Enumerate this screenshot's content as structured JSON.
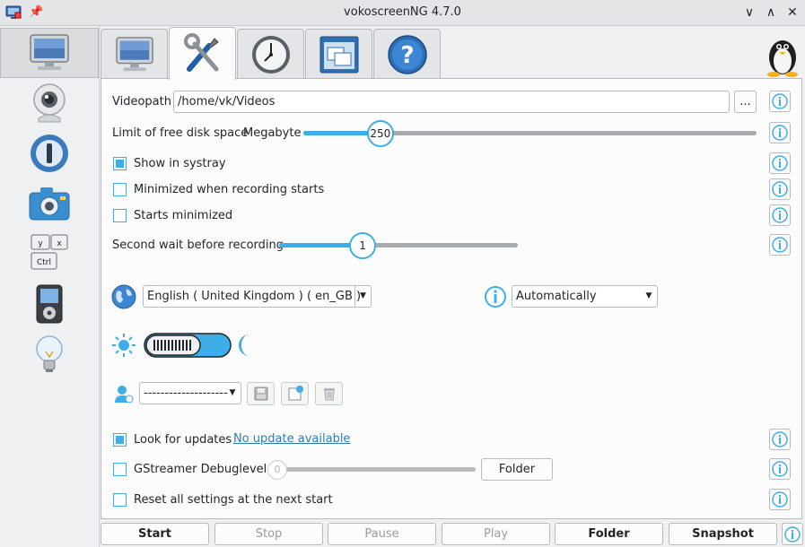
{
  "window": {
    "title": "vokoscreenNG 4.7.0",
    "pin_icon": "pin-icon",
    "controls": {
      "minimize": "∨",
      "maximize": "∧",
      "close": "✕"
    }
  },
  "sidebar": {
    "items": [
      {
        "name": "screen",
        "icon": "monitor-icon",
        "active": true
      },
      {
        "name": "webcam",
        "icon": "webcam-icon"
      },
      {
        "name": "player",
        "icon": "player-icon"
      },
      {
        "name": "camera",
        "icon": "camera-icon"
      },
      {
        "name": "keys",
        "icon": "keyboard-keys-icon",
        "keys": [
          "y",
          "x",
          "Ctrl"
        ]
      },
      {
        "name": "media-player",
        "icon": "media-player-icon"
      },
      {
        "name": "tips",
        "icon": "lightbulb-icon"
      }
    ]
  },
  "tabs": [
    {
      "name": "screen",
      "icon": "monitor-icon"
    },
    {
      "name": "settings",
      "icon": "tools-icon",
      "active": true
    },
    {
      "name": "timer",
      "icon": "clock-icon"
    },
    {
      "name": "windows",
      "icon": "windows-icon"
    },
    {
      "name": "help",
      "icon": "help-icon",
      "glyph": "?"
    }
  ],
  "settings": {
    "videopath_label": "Videopath",
    "videopath_value": "/home/vk/Videos",
    "browse_label": "...",
    "disk_space_label": "Limit of free disk space",
    "disk_space_unit": "Megabyte",
    "disk_space_value": "250",
    "disk_space_fraction": 0.17,
    "show_systray_label": "Show in systray",
    "show_systray_checked": true,
    "minimized_recording_label": "Minimized when recording starts",
    "minimized_recording_checked": false,
    "starts_minimized_label": "Starts minimized",
    "starts_minimized_checked": false,
    "wait_label": "Second wait before recording",
    "wait_value": "1",
    "wait_fraction": 0.35,
    "language_value": "English  ( United Kingdom )  ( en_GB )",
    "style_value": "Automatically",
    "theme_toggle": "dark-mode-toggle",
    "profile_value": "--------------------",
    "look_updates_label": "Look for updates",
    "look_updates_checked": true,
    "update_link": "No update available",
    "gstreamer_label": "GStreamer Debuglevel",
    "gstreamer_checked": false,
    "gstreamer_value": "0",
    "gstreamer_folder_label": "Folder",
    "reset_label": "Reset all settings at the next start",
    "reset_checked": false
  },
  "bottom_bar": {
    "start": "Start",
    "stop": "Stop",
    "pause": "Pause",
    "play": "Play",
    "folder": "Folder",
    "snapshot": "Snapshot"
  },
  "colors": {
    "accent": "#3daee9",
    "link": "#2980b9",
    "background": "#eff0f1",
    "panel": "#fcfcfc"
  }
}
